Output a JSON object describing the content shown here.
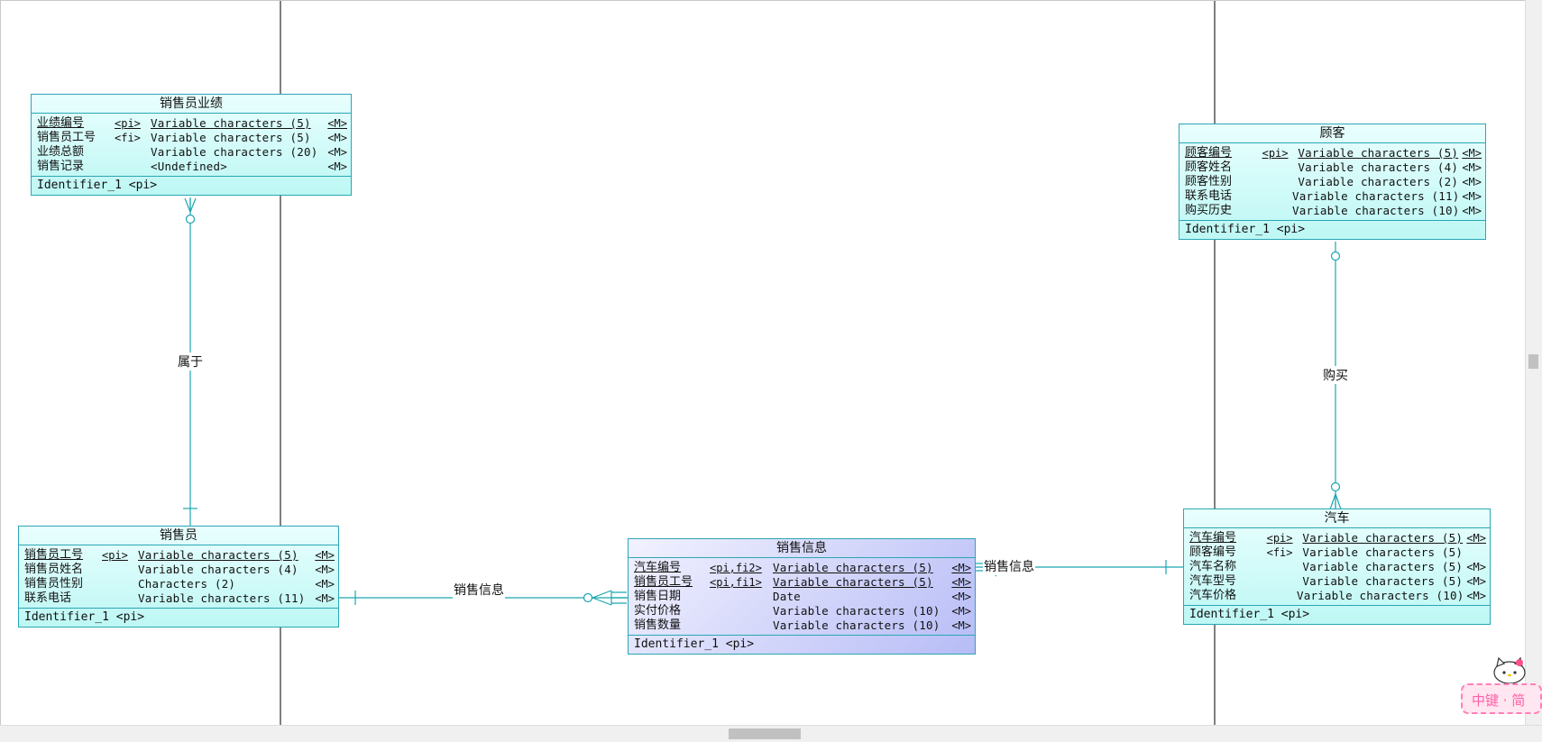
{
  "entities": {
    "salesperf": {
      "title": "销售员业绩",
      "attrs": [
        {
          "name": "业绩编号",
          "key": "<pi>",
          "type": "Variable characters (5)",
          "m": "<M>",
          "u": true
        },
        {
          "name": "销售员工号",
          "key": "<fi>",
          "type": "Variable characters (5)",
          "m": "<M>",
          "u": false
        },
        {
          "name": "业绩总额",
          "key": "",
          "type": "Variable characters (20)",
          "m": "<M>",
          "u": false
        },
        {
          "name": "销售记录",
          "key": "",
          "type": "<Undefined>",
          "m": "<M>",
          "u": false
        }
      ],
      "identifier": "Identifier_1 <pi>"
    },
    "customer": {
      "title": "顾客",
      "attrs": [
        {
          "name": "顾客编号",
          "key": "<pi>",
          "type": "Variable characters (5)",
          "m": "<M>",
          "u": true
        },
        {
          "name": "顾客姓名",
          "key": "",
          "type": "Variable characters (4)",
          "m": "<M>",
          "u": false
        },
        {
          "name": "顾客性别",
          "key": "",
          "type": "Variable characters (2)",
          "m": "<M>",
          "u": false
        },
        {
          "name": "联系电话",
          "key": "",
          "type": "Variable characters (11)",
          "m": "<M>",
          "u": false
        },
        {
          "name": "购买历史",
          "key": "",
          "type": "Variable characters (10)",
          "m": "<M>",
          "u": false
        }
      ],
      "identifier": "Identifier_1 <pi>"
    },
    "salesperson": {
      "title": "销售员",
      "attrs": [
        {
          "name": "销售员工号",
          "key": "<pi>",
          "type": "Variable characters (5)",
          "m": "<M>",
          "u": true
        },
        {
          "name": "销售员姓名",
          "key": "",
          "type": "Variable characters (4)",
          "m": "<M>",
          "u": false
        },
        {
          "name": "销售员性别",
          "key": "",
          "type": "Characters (2)",
          "m": "<M>",
          "u": false
        },
        {
          "name": "联系电话",
          "key": "",
          "type": "Variable characters (11)",
          "m": "<M>",
          "u": false
        }
      ],
      "identifier": "Identifier_1 <pi>"
    },
    "salesinfo": {
      "title": "销售信息",
      "attrs": [
        {
          "name": "汽车编号",
          "key": "<pi,fi2>",
          "type": "Variable characters (5)",
          "m": "<M>",
          "u": true
        },
        {
          "name": "销售员工号",
          "key": "<pi,fi1>",
          "type": "Variable characters (5)",
          "m": "<M>",
          "u": true
        },
        {
          "name": "销售日期",
          "key": "",
          "type": "Date",
          "m": "<M>",
          "u": false
        },
        {
          "name": "实付价格",
          "key": "",
          "type": "Variable characters (10)",
          "m": "<M>",
          "u": false
        },
        {
          "name": "销售数量",
          "key": "",
          "type": "Variable characters (10)",
          "m": "<M>",
          "u": false
        }
      ],
      "identifier": "Identifier_1 <pi>"
    },
    "car": {
      "title": "汽车",
      "attrs": [
        {
          "name": "汽车编号",
          "key": "<pi>",
          "type": "Variable characters (5)",
          "m": "<M>",
          "u": true
        },
        {
          "name": "顾客编号",
          "key": "<fi>",
          "type": "Variable characters (5)",
          "m": "",
          "u": false
        },
        {
          "name": "汽车名称",
          "key": "",
          "type": "Variable characters (5)",
          "m": "<M>",
          "u": false
        },
        {
          "name": "汽车型号",
          "key": "",
          "type": "Variable characters (5)",
          "m": "<M>",
          "u": false
        },
        {
          "name": "汽车价格",
          "key": "",
          "type": "Variable characters (10)",
          "m": "<M>",
          "u": false
        }
      ],
      "identifier": "Identifier_1 <pi>"
    }
  },
  "relationships": {
    "belongs": "属于",
    "buys": "购买",
    "sales_left": "销售信息",
    "sales_right": "销售信息"
  },
  "ime": {
    "text": "中键 · 简"
  }
}
